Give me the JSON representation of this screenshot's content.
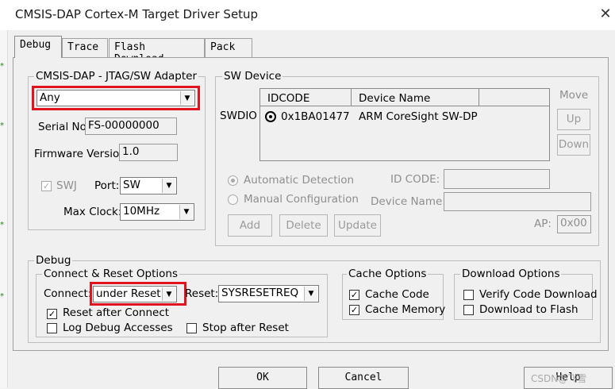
{
  "window": {
    "title": "CMSIS-DAP Cortex-M Target Driver Setup",
    "close_glyph": "✕"
  },
  "tabs": [
    "Debug",
    "Trace",
    "Flash Download",
    "Pack"
  ],
  "adapter": {
    "group_label": "CMSIS-DAP - JTAG/SW Adapter",
    "selected": "Any",
    "serial_label": "Serial No:",
    "serial_value": "FS-00000000",
    "firmware_label": "Firmware Version:",
    "firmware_value": "1.0",
    "swj_label": "SWJ",
    "port_label": "Port:",
    "port_value": "SW",
    "maxclock_label": "Max Clock:",
    "maxclock_value": "10MHz"
  },
  "sw_device": {
    "group_label": "SW Device",
    "row_label": "SWDIO",
    "columns": [
      "IDCODE",
      "Device Name"
    ],
    "rows": [
      {
        "idcode": "0x1BA01477",
        "device_name": "ARM CoreSight SW-DP"
      }
    ],
    "move_label": "Move",
    "up_label": "Up",
    "down_label": "Down",
    "auto_label": "Automatic Detection",
    "manual_label": "Manual Configuration",
    "idcode_label": "ID CODE:",
    "devname_label": "Device Name:",
    "add_label": "Add",
    "delete_label": "Delete",
    "update_label": "Update",
    "ap_label": "AP:",
    "ap_value": "0x00"
  },
  "debug": {
    "group_label": "Debug",
    "connect_reset_label": "Connect & Reset Options",
    "connect_label": "Connect:",
    "connect_value": "under Reset",
    "reset_label": "Reset:",
    "reset_value": "SYSRESETREQ",
    "reset_after_connect": "Reset after Connect",
    "log_debug": "Log Debug Accesses",
    "stop_after_reset": "Stop after Reset",
    "cache_label": "Cache Options",
    "cache_code": "Cache Code",
    "cache_memory": "Cache Memory",
    "download_label": "Download Options",
    "verify_download": "Verify Code Download",
    "download_flash": "Download to Flash"
  },
  "buttons": {
    "ok": "OK",
    "cancel": "Cancel",
    "help": "Help"
  },
  "watermark": "CSDN@飞雪",
  "colors": {
    "highlight": "#e0141e",
    "selection_dot": "#000000"
  }
}
